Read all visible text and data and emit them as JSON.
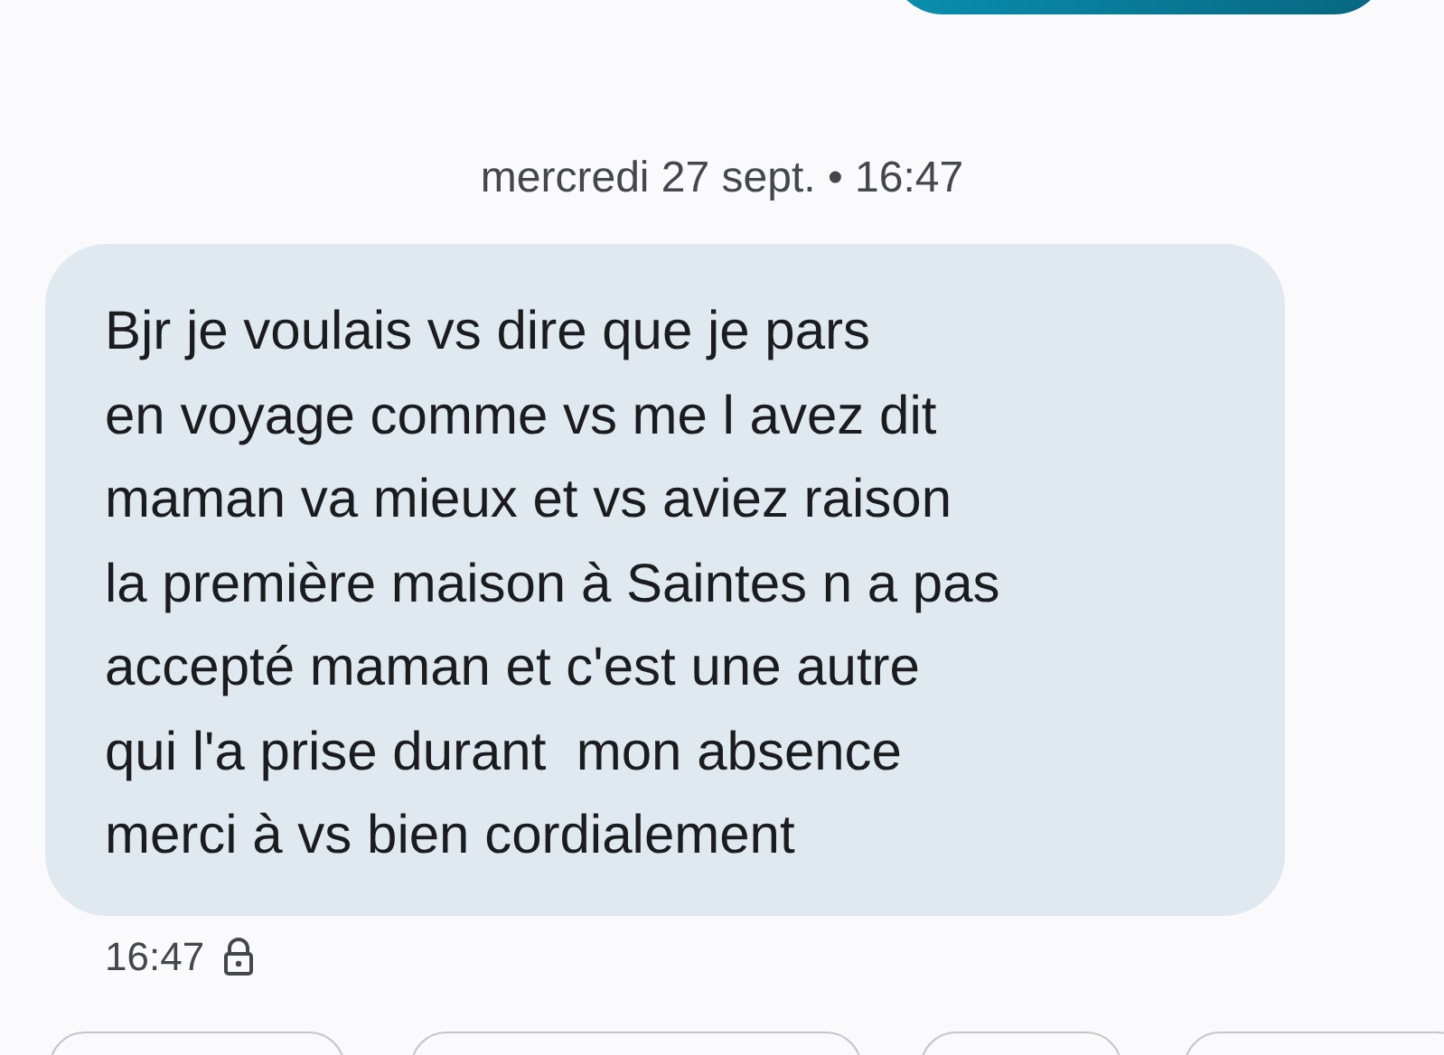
{
  "date_divider": "mercredi 27 sept. • 16:47",
  "message": {
    "text": "Bjr je voulais vs dire que je pars\nen voyage comme vs me l avez dit\nmaman va mieux et vs aviez raison\nla première maison à Saintes n a pas\naccepté maman et c'est une autre\nqui l'a prise durant  mon absence\nmerci à vs bien cordialement",
    "time": "16:47",
    "locked": true
  }
}
